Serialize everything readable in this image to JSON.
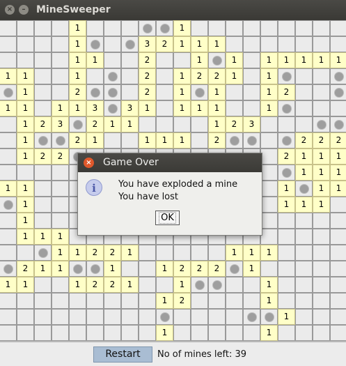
{
  "window": {
    "title": "MineSweeper",
    "close_icon": "close-icon",
    "minimize_icon": "minimize-icon"
  },
  "board": {
    "rows": 20,
    "cols": 20,
    "legend": "'.' = unrevealed, 'M' = mine, digit = revealed number, '0' = revealed empty",
    "grid": [
      "....1...MM1.........",
      "....1M.M32111.......",
      "....11..2..1M1.11111",
      "11..1.M.2.1221.1M..M",
      "M1..2MM.2.1M1..12..M",
      "11.113M31.111..1M...",
      ".123M211....123...MM",
      ".1MM21..111.2MM.M222",
      ".122M...........2111",
      "................M111",
      "11..............1M11",
      "M1..............111.",
      ".1..................",
      ".111................",
      "..M11221.....111....",
      "M211MM1..1222M1.....",
      "11..1221..1MM..1....",
      ".........12....1....",
      ".........M....MM1...",
      ".........1.....1...."
    ]
  },
  "dialog": {
    "title": "Game Over",
    "close_icon": "close-icon",
    "info_icon": "info-icon",
    "line1": "You have exploded a mine",
    "line2": "You have lost",
    "ok_label": "OK"
  },
  "footer": {
    "restart_label": "Restart",
    "mines_label": "No of mines left:",
    "mines_left": "39"
  }
}
